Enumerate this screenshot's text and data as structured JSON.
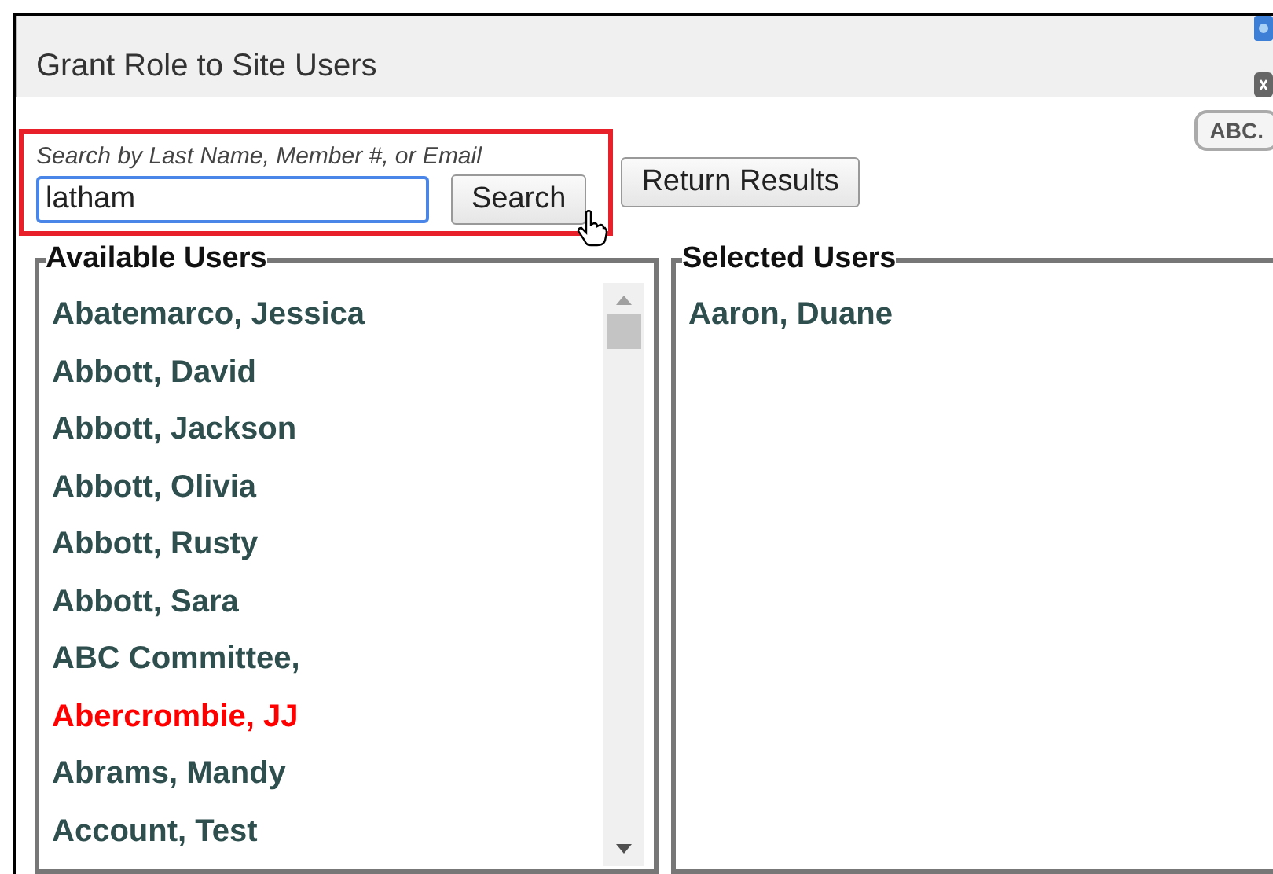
{
  "window": {
    "title": "Grant Role to Site Users"
  },
  "search": {
    "label": "Search by Last Name, Member #, or Email",
    "value": "latham",
    "button": "Search"
  },
  "return_button": "Return Results",
  "abc_button": "ABC.",
  "available_users": {
    "title": "Available Users",
    "items": [
      {
        "name": "Abatemarco, Jessica",
        "color": "#2f4f4f"
      },
      {
        "name": "Abbott, David",
        "color": "#2f4f4f"
      },
      {
        "name": "Abbott, Jackson",
        "color": "#2f4f4f"
      },
      {
        "name": "Abbott, Olivia",
        "color": "#2f4f4f"
      },
      {
        "name": "Abbott, Rusty",
        "color": "#2f4f4f"
      },
      {
        "name": "Abbott, Sara",
        "color": "#2f4f4f"
      },
      {
        "name": "ABC Committee,",
        "color": "#2f4f4f"
      },
      {
        "name": "Abercrombie, JJ",
        "color": "#ff0000"
      },
      {
        "name": "Abrams, Mandy",
        "color": "#2f4f4f"
      },
      {
        "name": "Account, Test",
        "color": "#2f4f4f"
      }
    ]
  },
  "selected_users": {
    "title": "Selected Users",
    "items": [
      {
        "name": "Aaron, Duane"
      }
    ]
  }
}
